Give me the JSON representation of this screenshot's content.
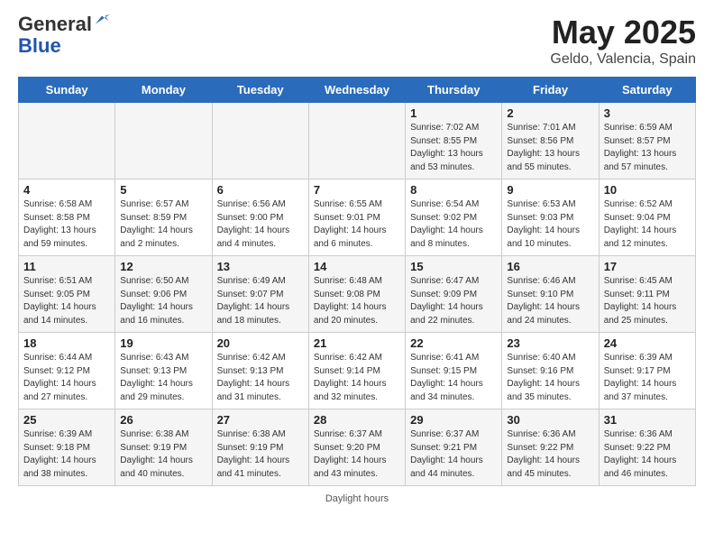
{
  "logo": {
    "general": "General",
    "blue": "Blue"
  },
  "title": "May 2025",
  "subtitle": "Geldo, Valencia, Spain",
  "days_of_week": [
    "Sunday",
    "Monday",
    "Tuesday",
    "Wednesday",
    "Thursday",
    "Friday",
    "Saturday"
  ],
  "weeks": [
    [
      {
        "day": "",
        "info": ""
      },
      {
        "day": "",
        "info": ""
      },
      {
        "day": "",
        "info": ""
      },
      {
        "day": "",
        "info": ""
      },
      {
        "day": "1",
        "info": "Sunrise: 7:02 AM\nSunset: 8:55 PM\nDaylight: 13 hours\nand 53 minutes."
      },
      {
        "day": "2",
        "info": "Sunrise: 7:01 AM\nSunset: 8:56 PM\nDaylight: 13 hours\nand 55 minutes."
      },
      {
        "day": "3",
        "info": "Sunrise: 6:59 AM\nSunset: 8:57 PM\nDaylight: 13 hours\nand 57 minutes."
      }
    ],
    [
      {
        "day": "4",
        "info": "Sunrise: 6:58 AM\nSunset: 8:58 PM\nDaylight: 13 hours\nand 59 minutes."
      },
      {
        "day": "5",
        "info": "Sunrise: 6:57 AM\nSunset: 8:59 PM\nDaylight: 14 hours\nand 2 minutes."
      },
      {
        "day": "6",
        "info": "Sunrise: 6:56 AM\nSunset: 9:00 PM\nDaylight: 14 hours\nand 4 minutes."
      },
      {
        "day": "7",
        "info": "Sunrise: 6:55 AM\nSunset: 9:01 PM\nDaylight: 14 hours\nand 6 minutes."
      },
      {
        "day": "8",
        "info": "Sunrise: 6:54 AM\nSunset: 9:02 PM\nDaylight: 14 hours\nand 8 minutes."
      },
      {
        "day": "9",
        "info": "Sunrise: 6:53 AM\nSunset: 9:03 PM\nDaylight: 14 hours\nand 10 minutes."
      },
      {
        "day": "10",
        "info": "Sunrise: 6:52 AM\nSunset: 9:04 PM\nDaylight: 14 hours\nand 12 minutes."
      }
    ],
    [
      {
        "day": "11",
        "info": "Sunrise: 6:51 AM\nSunset: 9:05 PM\nDaylight: 14 hours\nand 14 minutes."
      },
      {
        "day": "12",
        "info": "Sunrise: 6:50 AM\nSunset: 9:06 PM\nDaylight: 14 hours\nand 16 minutes."
      },
      {
        "day": "13",
        "info": "Sunrise: 6:49 AM\nSunset: 9:07 PM\nDaylight: 14 hours\nand 18 minutes."
      },
      {
        "day": "14",
        "info": "Sunrise: 6:48 AM\nSunset: 9:08 PM\nDaylight: 14 hours\nand 20 minutes."
      },
      {
        "day": "15",
        "info": "Sunrise: 6:47 AM\nSunset: 9:09 PM\nDaylight: 14 hours\nand 22 minutes."
      },
      {
        "day": "16",
        "info": "Sunrise: 6:46 AM\nSunset: 9:10 PM\nDaylight: 14 hours\nand 24 minutes."
      },
      {
        "day": "17",
        "info": "Sunrise: 6:45 AM\nSunset: 9:11 PM\nDaylight: 14 hours\nand 25 minutes."
      }
    ],
    [
      {
        "day": "18",
        "info": "Sunrise: 6:44 AM\nSunset: 9:12 PM\nDaylight: 14 hours\nand 27 minutes."
      },
      {
        "day": "19",
        "info": "Sunrise: 6:43 AM\nSunset: 9:13 PM\nDaylight: 14 hours\nand 29 minutes."
      },
      {
        "day": "20",
        "info": "Sunrise: 6:42 AM\nSunset: 9:13 PM\nDaylight: 14 hours\nand 31 minutes."
      },
      {
        "day": "21",
        "info": "Sunrise: 6:42 AM\nSunset: 9:14 PM\nDaylight: 14 hours\nand 32 minutes."
      },
      {
        "day": "22",
        "info": "Sunrise: 6:41 AM\nSunset: 9:15 PM\nDaylight: 14 hours\nand 34 minutes."
      },
      {
        "day": "23",
        "info": "Sunrise: 6:40 AM\nSunset: 9:16 PM\nDaylight: 14 hours\nand 35 minutes."
      },
      {
        "day": "24",
        "info": "Sunrise: 6:39 AM\nSunset: 9:17 PM\nDaylight: 14 hours\nand 37 minutes."
      }
    ],
    [
      {
        "day": "25",
        "info": "Sunrise: 6:39 AM\nSunset: 9:18 PM\nDaylight: 14 hours\nand 38 minutes."
      },
      {
        "day": "26",
        "info": "Sunrise: 6:38 AM\nSunset: 9:19 PM\nDaylight: 14 hours\nand 40 minutes."
      },
      {
        "day": "27",
        "info": "Sunrise: 6:38 AM\nSunset: 9:19 PM\nDaylight: 14 hours\nand 41 minutes."
      },
      {
        "day": "28",
        "info": "Sunrise: 6:37 AM\nSunset: 9:20 PM\nDaylight: 14 hours\nand 43 minutes."
      },
      {
        "day": "29",
        "info": "Sunrise: 6:37 AM\nSunset: 9:21 PM\nDaylight: 14 hours\nand 44 minutes."
      },
      {
        "day": "30",
        "info": "Sunrise: 6:36 AM\nSunset: 9:22 PM\nDaylight: 14 hours\nand 45 minutes."
      },
      {
        "day": "31",
        "info": "Sunrise: 6:36 AM\nSunset: 9:22 PM\nDaylight: 14 hours\nand 46 minutes."
      }
    ]
  ],
  "footer": "Daylight hours"
}
